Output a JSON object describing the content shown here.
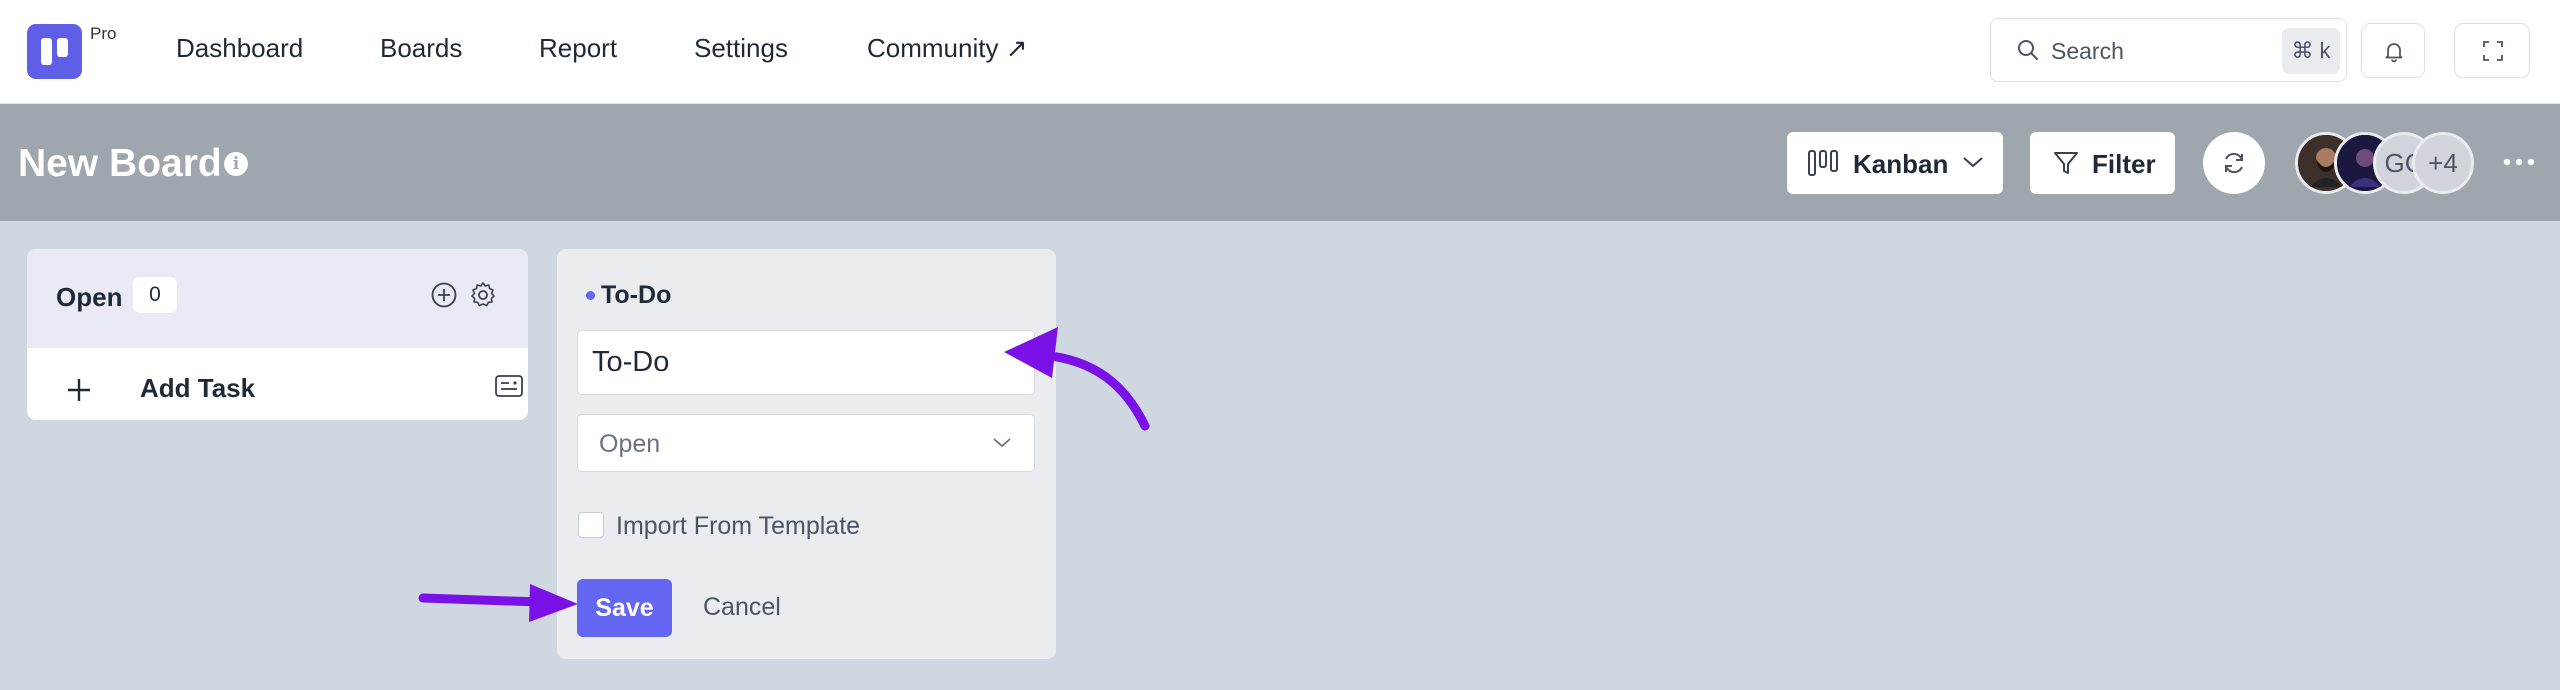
{
  "app": {
    "badge": "Pro",
    "nav": [
      "Dashboard",
      "Boards",
      "Report",
      "Settings",
      "Community ↗"
    ],
    "search": {
      "label": "Search",
      "shortcut": "⌘ k"
    }
  },
  "board": {
    "title": "New Board",
    "info_icon": "i",
    "view_selector": {
      "label": "Kanban",
      "icon": "kanban-icon"
    },
    "filter_label": "Filter",
    "members": {
      "initials": "GC",
      "overflow": "+4"
    }
  },
  "columns": {
    "open": {
      "title": "Open",
      "count": "0",
      "add_task_label": "Add Task"
    },
    "todo": {
      "title": "To-Do",
      "name_value": "To-Do",
      "stage_select": "Open",
      "import_template_label": "Import From Template",
      "save_label": "Save",
      "cancel_label": "Cancel"
    }
  },
  "colors": {
    "accent": "#6366f1",
    "annotation_arrow": "#7a12e8",
    "header_bar": "#9fa6ae",
    "canvas": "#cfd8e1"
  }
}
